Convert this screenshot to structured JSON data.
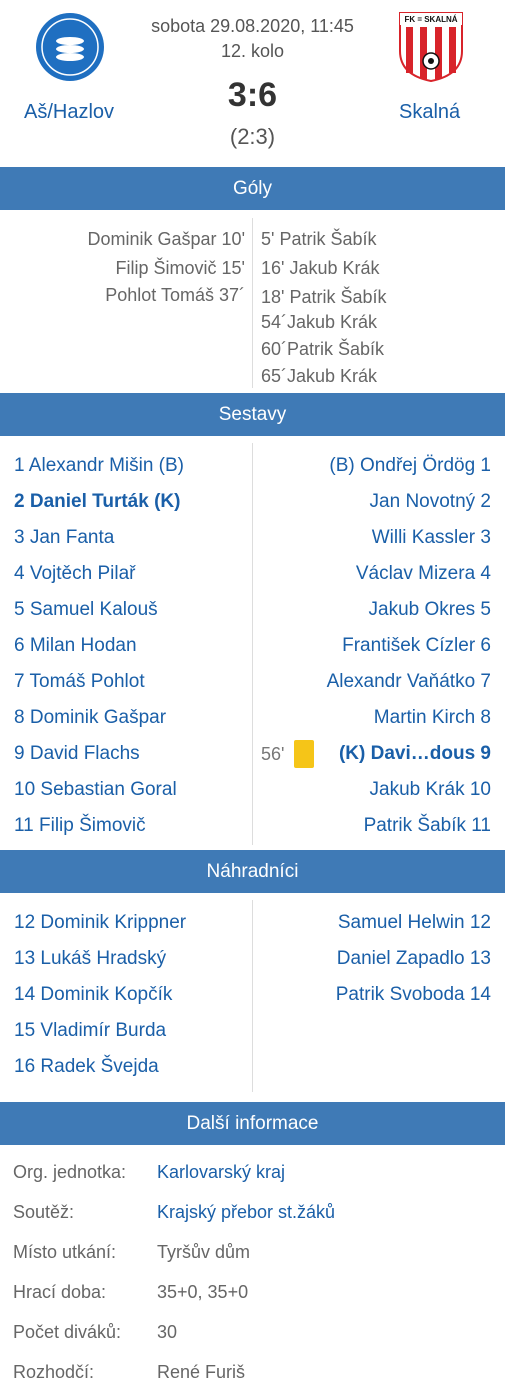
{
  "match": {
    "date_time": "sobota 29.08.2020, 11:45",
    "round": "12. kolo",
    "score": "3:6",
    "halftime": "(2:3)",
    "home_team": "Aš/Hazlov",
    "away_team": "Skalná",
    "home_logo_text": "TJ JISKRA AŠ FOTBAL",
    "away_logo_text": "FK = SKALNÁ"
  },
  "sections": {
    "goals": "Góly",
    "lineups": "Sestavy",
    "subs": "Náhradníci",
    "info": "Další informace"
  },
  "goals": {
    "home": [
      "Dominik Gašpar 10'",
      "Filip Šimovič 15'",
      "Pohlot Tomáš 37´"
    ],
    "away": [
      "5' Patrik Šabík",
      "16' Jakub Krák",
      "18' Patrik Šabík",
      "54´Jakub Krák",
      "60´Patrik Šabík",
      "65´Jakub Krák"
    ]
  },
  "lineups": {
    "home": [
      "1 Alexandr Mišin (B)",
      "2 Daniel Turták (K)",
      "3 Jan Fanta",
      "4 Vojtěch Pilař",
      "5 Samuel Kalouš",
      "6 Milan Hodan",
      "7 Tomáš Pohlot",
      "8 Dominik Gašpar",
      "9 David Flachs",
      "10 Sebastian Goral",
      "11 Filip Šimovič"
    ],
    "away": [
      "(B) Ondřej Ördög 1",
      "Jan Novotný 2",
      "Willi Kassler 3",
      "Václav Mizera 4",
      "Jakub Okres 5",
      "František Cízler 6",
      "Alexandr Vaňátko 7",
      "Martin Kirch 8",
      "(K) Davi…dous 9",
      "Jakub Krák 10",
      "Patrik Šabík 11"
    ],
    "card_minute": "56'",
    "card_color": "#f5c518"
  },
  "subs": {
    "home": [
      "12 Dominik Krippner",
      "13 Lukáš Hradský",
      "14 Dominik Kopčík",
      "15 Vladimír Burda",
      "16 Radek Švejda"
    ],
    "away": [
      "Samuel Helwin 12",
      "Daniel Zapadlo 13",
      "Patrik Svoboda 14"
    ]
  },
  "info": {
    "org_label": "Org. jednotka:",
    "org_value": "Karlovarský kraj",
    "comp_label": "Soutěž:",
    "comp_value": "Krajský přebor st.žáků",
    "venue_label": "Místo utkání:",
    "venue_value": "Tyršův dům",
    "time_label": "Hrací doba:",
    "time_value": "35+0, 35+0",
    "spect_label": "Počet diváků:",
    "spect_value": "30",
    "ref_label": "Rozhodčí:",
    "ref_value": "René Furiš"
  },
  "colors": {
    "accent": "#3f7ab6",
    "link": "#1a5fa8",
    "away_red": "#d8232a"
  }
}
